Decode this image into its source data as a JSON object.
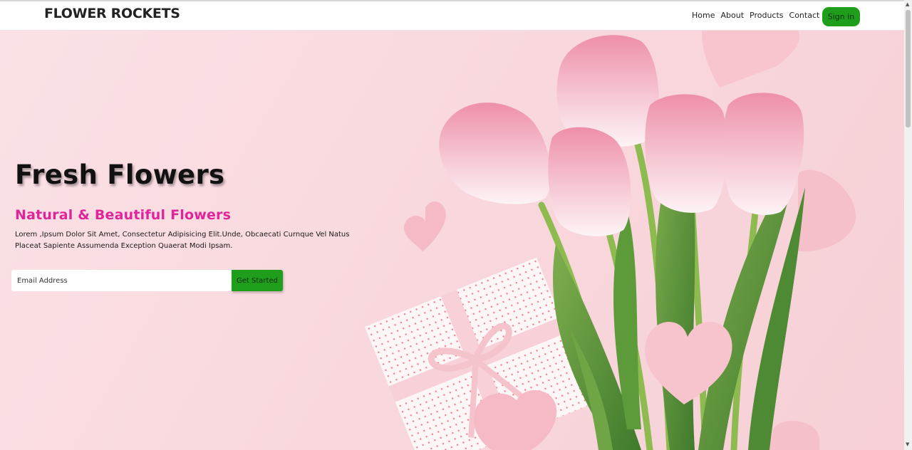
{
  "brand": "FLOWER ROCKETS",
  "nav": {
    "links": [
      "Home",
      "About",
      "Products",
      "Contact"
    ],
    "signin": "Sign in"
  },
  "hero": {
    "title": "Fresh Flowers",
    "subtitle": "Natural & Beautiful Flowers",
    "description": "Lorem ,Ipsum Dolor Sit Amet, Consectetur Adipisicing Elit.Unde, Obcaecati Curnque Vel Natus Placeat Sapiente Assumenda Exception Quaerat Modi Ipsam.",
    "email_placeholder": "Email Address",
    "cta": "Get Started"
  },
  "colors": {
    "accent_green": "#1f9e1c",
    "subtitle_pink": "#e0249a",
    "hero_bg": "#f8d7dc"
  }
}
